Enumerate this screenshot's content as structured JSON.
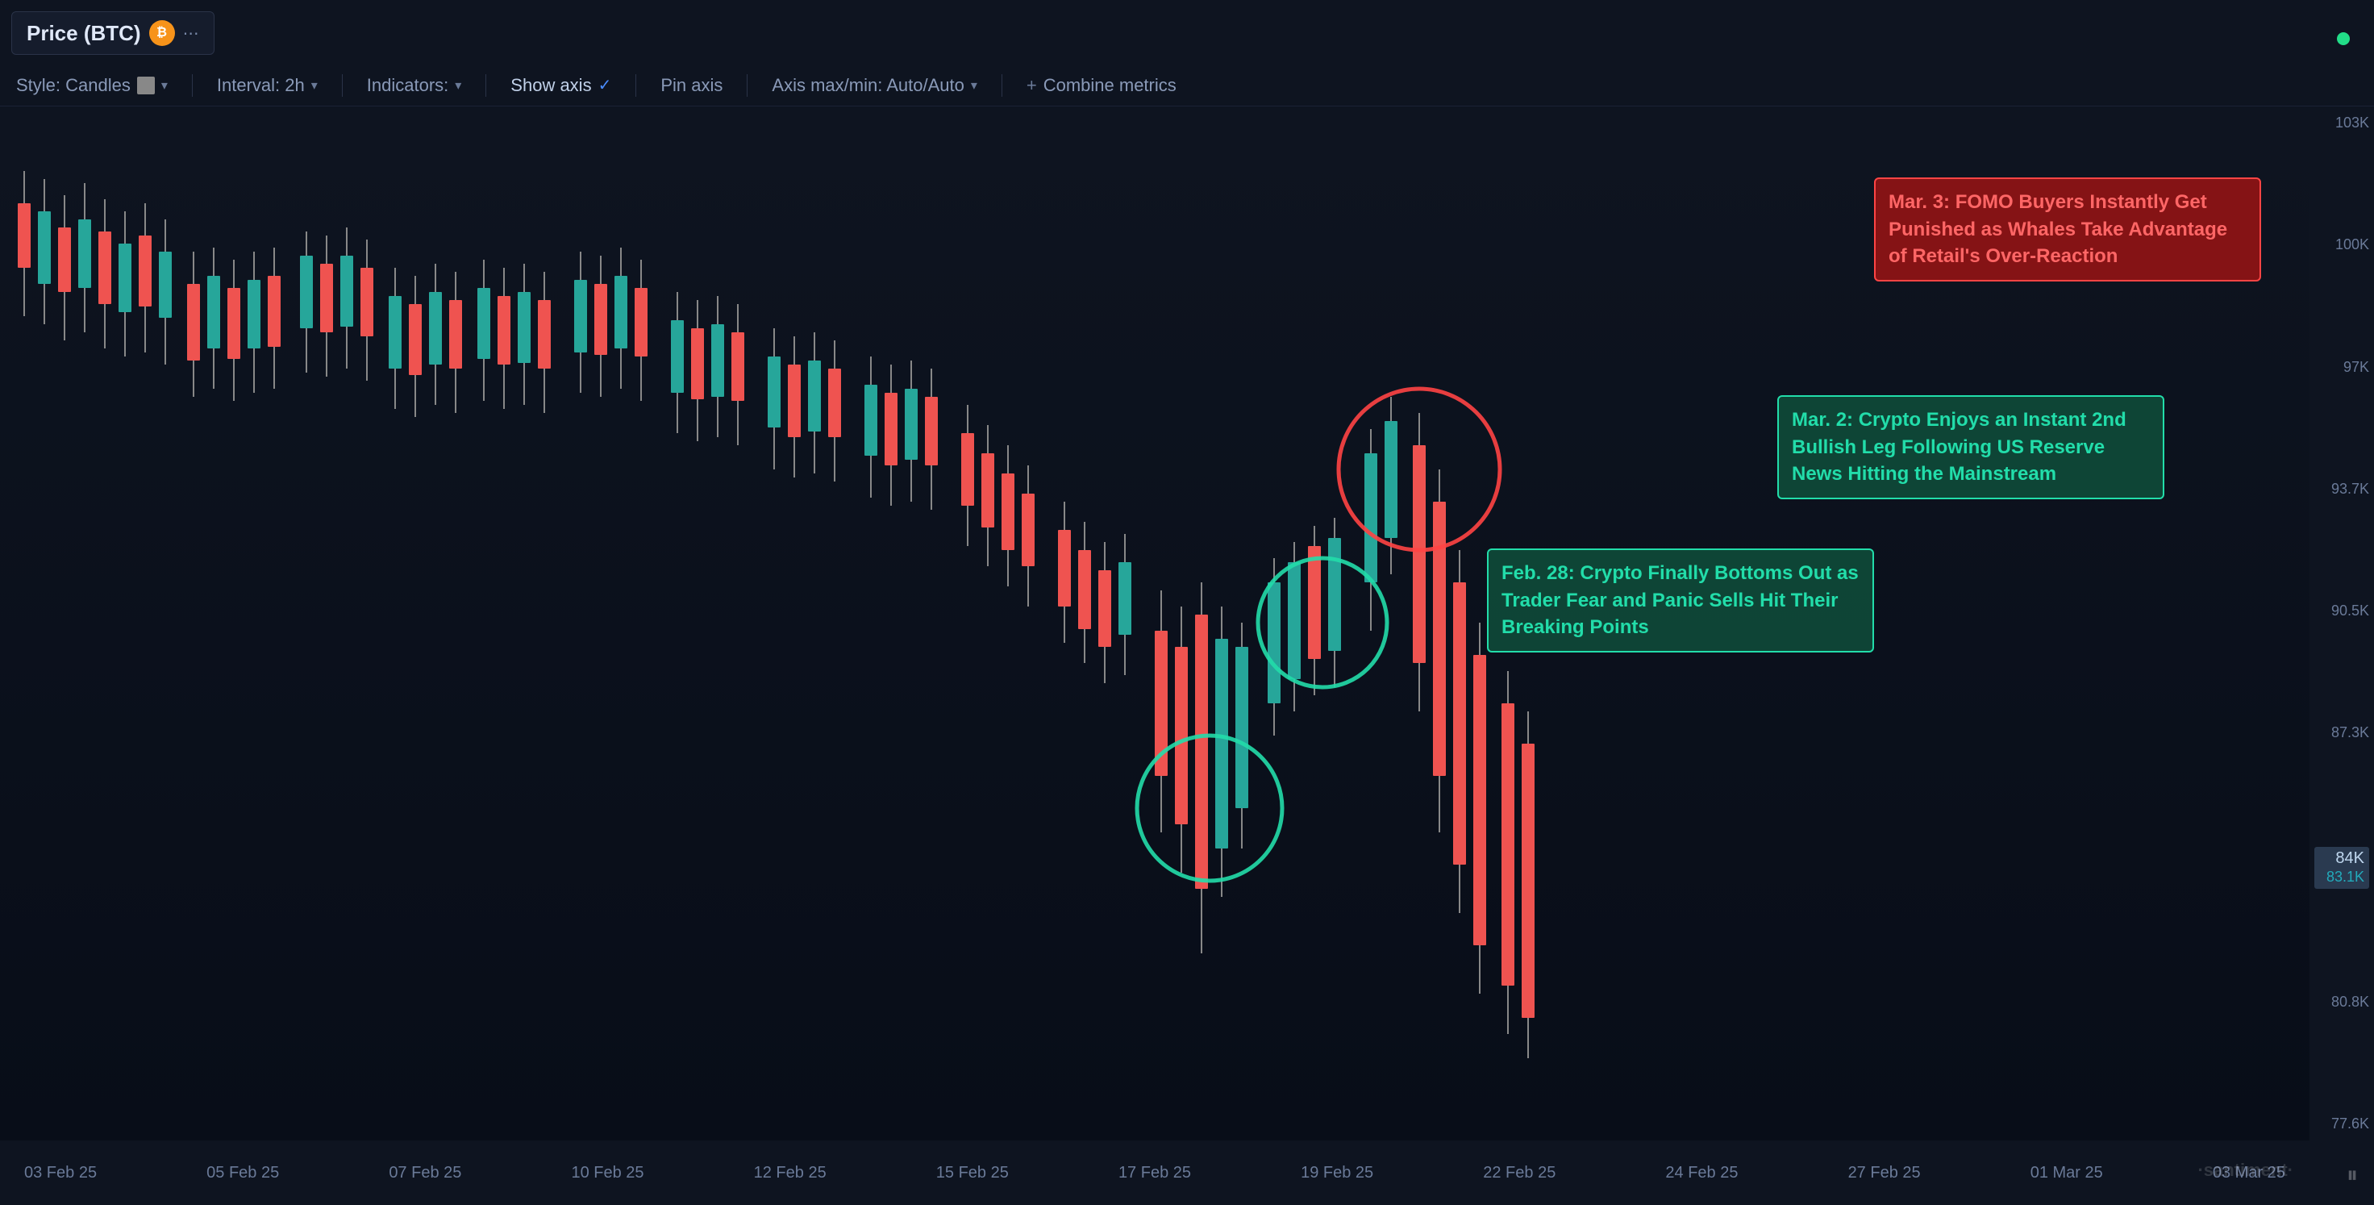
{
  "metric_label": {
    "text": "Price (BTC)",
    "btc_badge": "₿",
    "menu_icon": "⋯"
  },
  "toolbar": {
    "style_label": "Style: Candles",
    "color_swatch": "#888888",
    "interval_label": "Interval: 2h",
    "indicators_label": "Indicators:",
    "show_axis_label": "Show axis",
    "pin_axis_label": "Pin axis",
    "axis_maxmin_label": "Axis max/min: Auto/Auto",
    "combine_metrics_label": "Combine metrics"
  },
  "y_axis": {
    "labels": [
      "103K",
      "100K",
      "97K",
      "93.7K",
      "90.5K",
      "87.3K",
      "84K",
      "80.8K",
      "77.6K"
    ],
    "current_label": "83.1K"
  },
  "x_axis": {
    "labels": [
      "03 Feb 25",
      "05 Feb 25",
      "07 Feb 25",
      "10 Feb 25",
      "12 Feb 25",
      "15 Feb 25",
      "17 Feb 25",
      "19 Feb 25",
      "22 Feb 25",
      "24 Feb 25",
      "27 Feb 25",
      "01 Mar 25",
      "03 Mar 25"
    ]
  },
  "annotations": {
    "fomo": {
      "text": "Mar. 3: FOMO Buyers Instantly Get Punished as Whales Take Advantage of Retail's Over-Reaction",
      "color": "#ff4444",
      "bg": "rgba(180,30,30,0.75)"
    },
    "bullish": {
      "text": "Mar. 2: Crypto Enjoys an Instant 2nd Bullish Leg Following US Reserve News Hitting the Mainstream",
      "color": "#22ddaa",
      "bg": "rgba(20,100,80,0.75)"
    },
    "bottom": {
      "text": "Feb. 28: Crypto Finally Bottoms Out as Trader Fear and Panic Sells Hit Their Breaking Points",
      "color": "#22ddaa",
      "bg": "rgba(20,100,80,0.75)"
    }
  },
  "watermark": "·santiment·",
  "santiment_bottom": "·santiment·",
  "online_dot_color": "#22dd88"
}
